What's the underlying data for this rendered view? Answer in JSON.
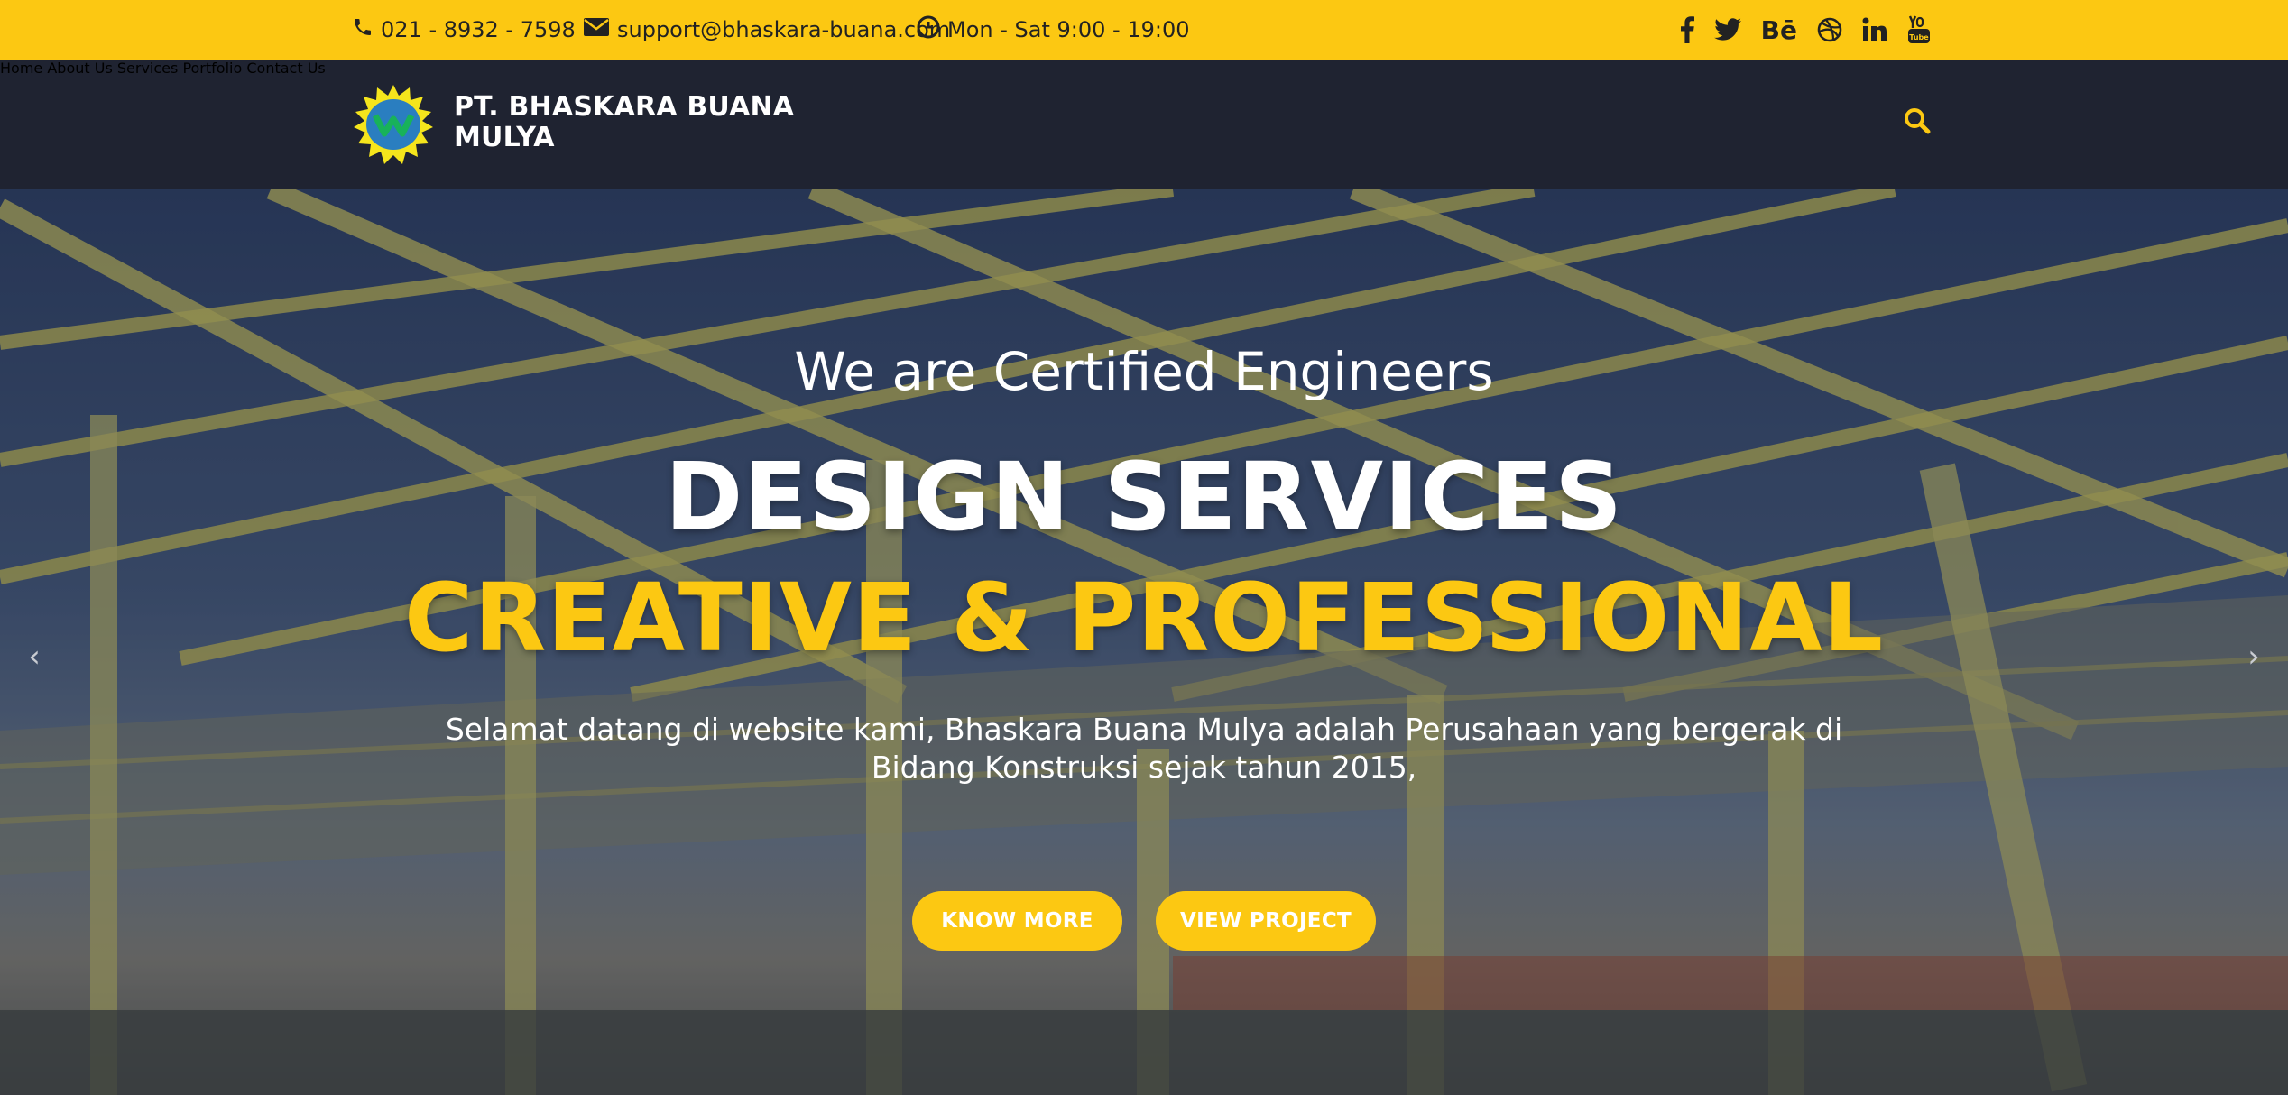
{
  "topbar": {
    "phone": "021 - 8932 - 7598",
    "email": "support@bhaskara-buana.com",
    "hours": "Mon - Sat 9:00 - 19:00",
    "social_icons": [
      "facebook-icon",
      "twitter-icon",
      "behance-icon",
      "dribbble-icon",
      "linkedin-icon",
      "youtube-icon"
    ],
    "behance_label": "Bē"
  },
  "nav": {
    "brand": "PT. BHASKARA BUANA MULYA",
    "items": [
      "Home",
      "About Us",
      "Services",
      "Portfolio",
      "Contact Us"
    ],
    "search_icon": "search-icon"
  },
  "hero": {
    "eyebrow": "We are Certified Engineers",
    "headline": "DESIGN SERVICES",
    "subheadline": "CREATIVE & PROFESSIONAL",
    "lead": "Selamat datang di website kami, Bhaskara Buana Mulya adalah Perusahaan yang bergerak di Bidang Konstruksi sejak tahun 2015,",
    "buttons": [
      "KNOW MORE",
      "VIEW PROJECT"
    ],
    "prev_icon": "chevron-left-icon",
    "next_icon": "chevron-right-icon"
  },
  "colors": {
    "accent": "#fcc812",
    "nav_bg": "#1f2331",
    "text_on_accent": "#222222"
  }
}
